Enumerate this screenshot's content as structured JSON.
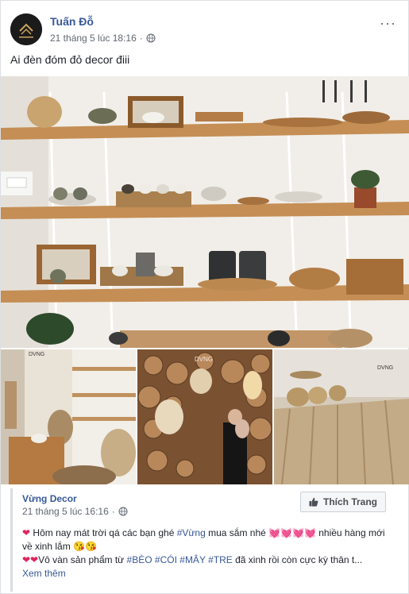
{
  "post": {
    "author": "Tuấn Đỗ",
    "timestamp": "21 tháng 5 lúc 18:16",
    "more_label": "···",
    "caption": "Ai đèn đóm đỏ decor điii"
  },
  "images": {
    "main_alt": "Kệ gỗ trưng bày đồ gốm",
    "thumb1_alt": "Góc cửa hàng",
    "thumb2_alt": "Tường gỗ và đèn mây",
    "thumb3_alt": "Thảm cói và giỏ"
  },
  "brand_mark": "DVNG",
  "shared_post": {
    "page_name": "Vừng Decor",
    "timestamp": "21 tháng 5 lúc 16:16",
    "like_button": "Thích Trang",
    "line1_start": "Hôm nay mát trời qá các bạn ghé ",
    "line1_tag": "#Vừng",
    "line1_mid": " mua sắm nhé ",
    "line1_end": " nhiều hàng mới về xinh lắm",
    "line2_start": "Vô vàn sản phẩm từ ",
    "tag_beo": "#BÈO",
    "tag_coi": "#CÓI",
    "tag_may": "#MÂY",
    "tag_tre": "#TRE",
    "line2_end": " đã xinh rồi còn cực kỳ thân t...",
    "see_more": "Xem thêm"
  },
  "colors": {
    "link_blue": "#385898",
    "meta_gray": "#616770",
    "heart_red": "#e0245e"
  },
  "icons": [
    "globe-icon",
    "more-icon",
    "thumbs-up-icon",
    "heart-icon",
    "kiss-emoji-icon"
  ]
}
